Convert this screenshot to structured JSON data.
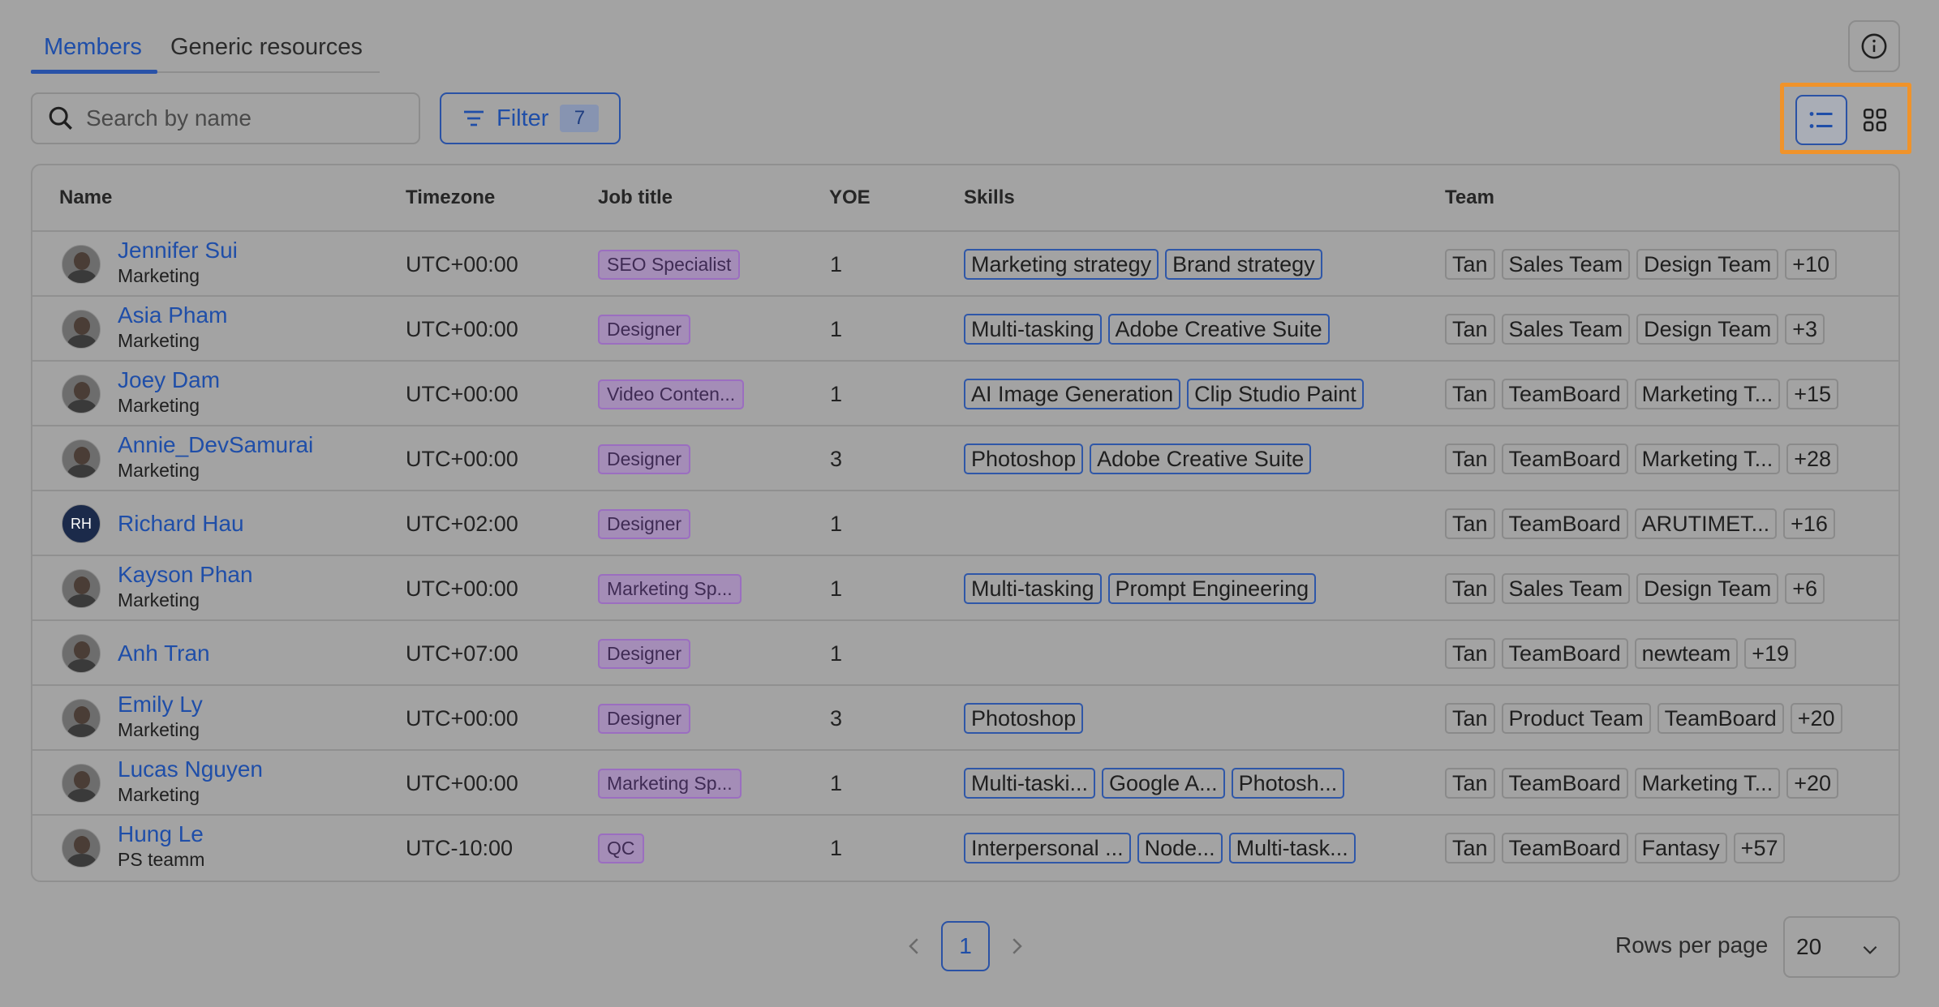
{
  "tabs": [
    {
      "label": "Members",
      "active": true
    },
    {
      "label": "Generic resources",
      "active": false
    }
  ],
  "search": {
    "placeholder": "Search by name",
    "value": ""
  },
  "filter": {
    "label": "Filter",
    "count": "7"
  },
  "view_toggle": {
    "selected": "list",
    "options": [
      "list",
      "grid"
    ]
  },
  "table": {
    "headers": {
      "name": "Name",
      "timezone": "Timezone",
      "job_title": "Job title",
      "yoe": "YOE",
      "skills": "Skills",
      "team": "Team"
    },
    "rows": [
      {
        "name": "Jennifer Sui",
        "dept": "Marketing",
        "timezone": "UTC+00:00",
        "job": "SEO Specialist",
        "yoe": "1",
        "skills": [
          "Marketing strategy",
          "Brand strategy"
        ],
        "teams": [
          "Tan",
          "Sales Team",
          "Design Team",
          "+10"
        ]
      },
      {
        "name": "Asia Pham",
        "dept": "Marketing",
        "timezone": "UTC+00:00",
        "job": "Designer",
        "yoe": "1",
        "skills": [
          "Multi-tasking",
          "Adobe Creative Suite"
        ],
        "teams": [
          "Tan",
          "Sales Team",
          "Design Team",
          "+3"
        ]
      },
      {
        "name": "Joey Dam",
        "dept": "Marketing",
        "timezone": "UTC+00:00",
        "job": "Video Conten...",
        "yoe": "1",
        "skills": [
          "AI Image Generation",
          "Clip Studio Paint"
        ],
        "teams": [
          "Tan",
          "TeamBoard",
          "Marketing T...",
          "+15"
        ]
      },
      {
        "name": "Annie_DevSamurai",
        "dept": "Marketing",
        "timezone": "UTC+00:00",
        "job": "Designer",
        "yoe": "3",
        "skills": [
          "Photoshop",
          "Adobe Creative Suite"
        ],
        "teams": [
          "Tan",
          "TeamBoard",
          "Marketing T...",
          "+28"
        ]
      },
      {
        "name": "Richard Hau",
        "dept": "",
        "initials": "RH",
        "timezone": "UTC+02:00",
        "job": "Designer",
        "yoe": "1",
        "skills": [],
        "teams": [
          "Tan",
          "TeamBoard",
          "ARUTIMET...",
          "+16"
        ]
      },
      {
        "name": "Kayson Phan",
        "dept": "Marketing",
        "timezone": "UTC+00:00",
        "job": "Marketing Sp...",
        "yoe": "1",
        "skills": [
          "Multi-tasking",
          "Prompt Engineering"
        ],
        "teams": [
          "Tan",
          "Sales Team",
          "Design Team",
          "+6"
        ]
      },
      {
        "name": "Anh Tran",
        "dept": "",
        "timezone": "UTC+07:00",
        "job": "Designer",
        "yoe": "1",
        "skills": [],
        "teams": [
          "Tan",
          "TeamBoard",
          "newteam",
          "+19"
        ]
      },
      {
        "name": "Emily Ly",
        "dept": "Marketing",
        "timezone": "UTC+00:00",
        "job": "Designer",
        "yoe": "3",
        "skills": [
          "Photoshop"
        ],
        "teams": [
          "Tan",
          "Product Team",
          "TeamBoard",
          "+20"
        ]
      },
      {
        "name": "Lucas Nguyen",
        "dept": "Marketing",
        "timezone": "UTC+00:00",
        "job": "Marketing Sp...",
        "yoe": "1",
        "skills": [
          "Multi-taski...",
          "Google A...",
          "Photosh..."
        ],
        "teams": [
          "Tan",
          "TeamBoard",
          "Marketing T...",
          "+20"
        ]
      },
      {
        "name": "Hung Le",
        "dept": "PS teamm",
        "timezone": "UTC-10:00",
        "job": "QC",
        "yoe": "1",
        "skills": [
          "Interpersonal ...",
          "Node...",
          "Multi-task..."
        ],
        "teams": [
          "Tan",
          "TeamBoard",
          "Fantasy",
          "+57"
        ]
      }
    ]
  },
  "pagination": {
    "current_page": "1",
    "rows_per_page_label": "Rows per page",
    "rows_per_page": "20"
  },
  "colors": {
    "accent": "#1f4ea8",
    "highlight": "#f0932a",
    "job_tag": "#9b6ec0"
  }
}
